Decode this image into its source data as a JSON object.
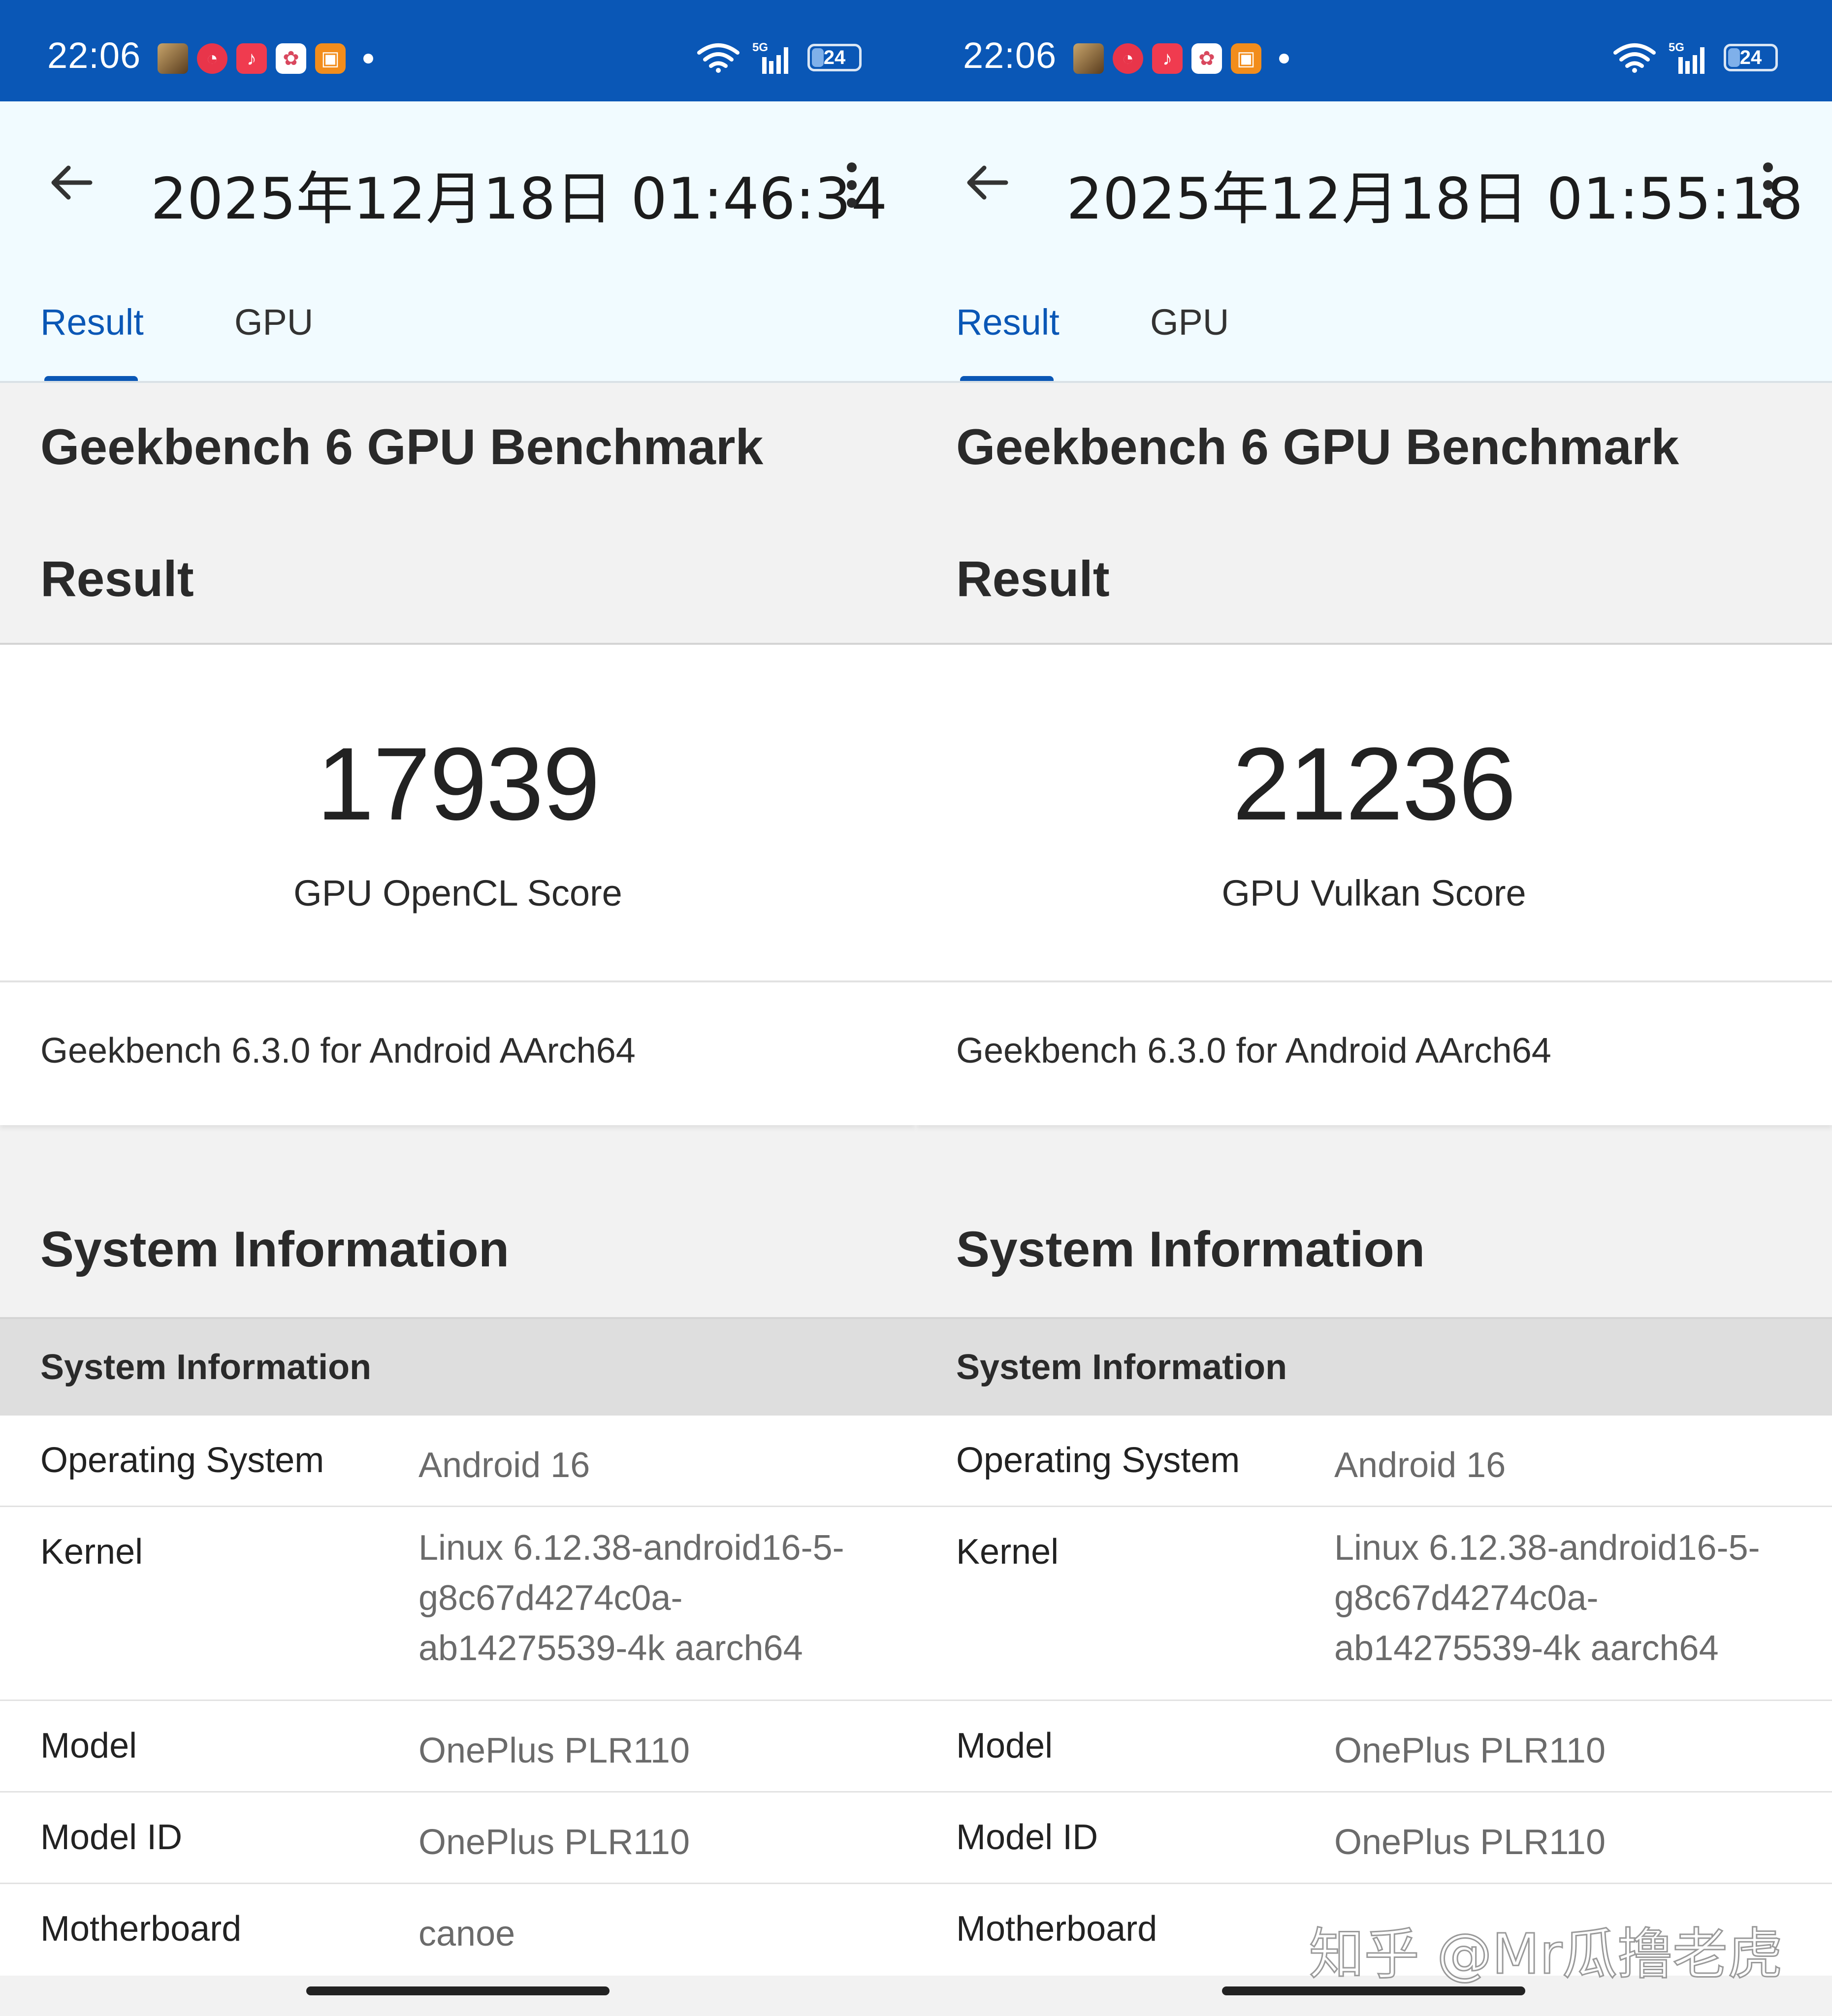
{
  "screens": [
    {
      "status_bar": {
        "time": "22:06",
        "signal_label": "5G",
        "battery": "24"
      },
      "title": "2025年12月18日 01:46:34",
      "tabs": [
        "Result",
        "GPU"
      ],
      "benchmark_title": "Geekbench 6 GPU Benchmark",
      "benchmark_subtitle": "Result",
      "score": "17939",
      "score_label": "GPU OpenCL Score",
      "version": "Geekbench 6.3.0 for Android AArch64",
      "sysinfo_heading": "System Information",
      "sysinfo_subheader": "System Information",
      "rows": [
        {
          "key": "Operating System",
          "value": "Android 16"
        },
        {
          "key": "Kernel",
          "value_lines": [
            "Linux 6.12.38-android16-5-",
            "g8c67d4274c0a-",
            "ab14275539-4k aarch64"
          ]
        },
        {
          "key": "Model",
          "value": "OnePlus PLR110"
        },
        {
          "key": "Model ID",
          "value": "OnePlus PLR110"
        },
        {
          "key": "Motherboard",
          "value": "canoe"
        }
      ]
    },
    {
      "status_bar": {
        "time": "22:06",
        "signal_label": "5G",
        "battery": "24"
      },
      "title": "2025年12月18日 01:55:18",
      "tabs": [
        "Result",
        "GPU"
      ],
      "benchmark_title": "Geekbench 6 GPU Benchmark",
      "benchmark_subtitle": "Result",
      "score": "21236",
      "score_label": "GPU Vulkan Score",
      "version": "Geekbench 6.3.0 for Android AArch64",
      "sysinfo_heading": "System Information",
      "sysinfo_subheader": "System Information",
      "rows": [
        {
          "key": "Operating System",
          "value": "Android 16"
        },
        {
          "key": "Kernel",
          "value_lines": [
            "Linux 6.12.38-android16-5-",
            "g8c67d4274c0a-",
            "ab14275539-4k aarch64"
          ]
        },
        {
          "key": "Model",
          "value": "OnePlus PLR110"
        },
        {
          "key": "Model ID",
          "value": "OnePlus PLR110"
        },
        {
          "key": "Motherboard",
          "value": ""
        }
      ]
    }
  ],
  "watermark": "知乎 @Mr瓜撸老虎",
  "colors": {
    "status_bar": "#0a57b6",
    "accent": "#0a57b6",
    "app_bar": "#f1fbff"
  },
  "icons": {
    "back": "arrow-left-icon",
    "menu": "more-vert-icon",
    "wifi": "wifi-icon",
    "signal": "signal-icon",
    "battery": "battery-icon"
  }
}
